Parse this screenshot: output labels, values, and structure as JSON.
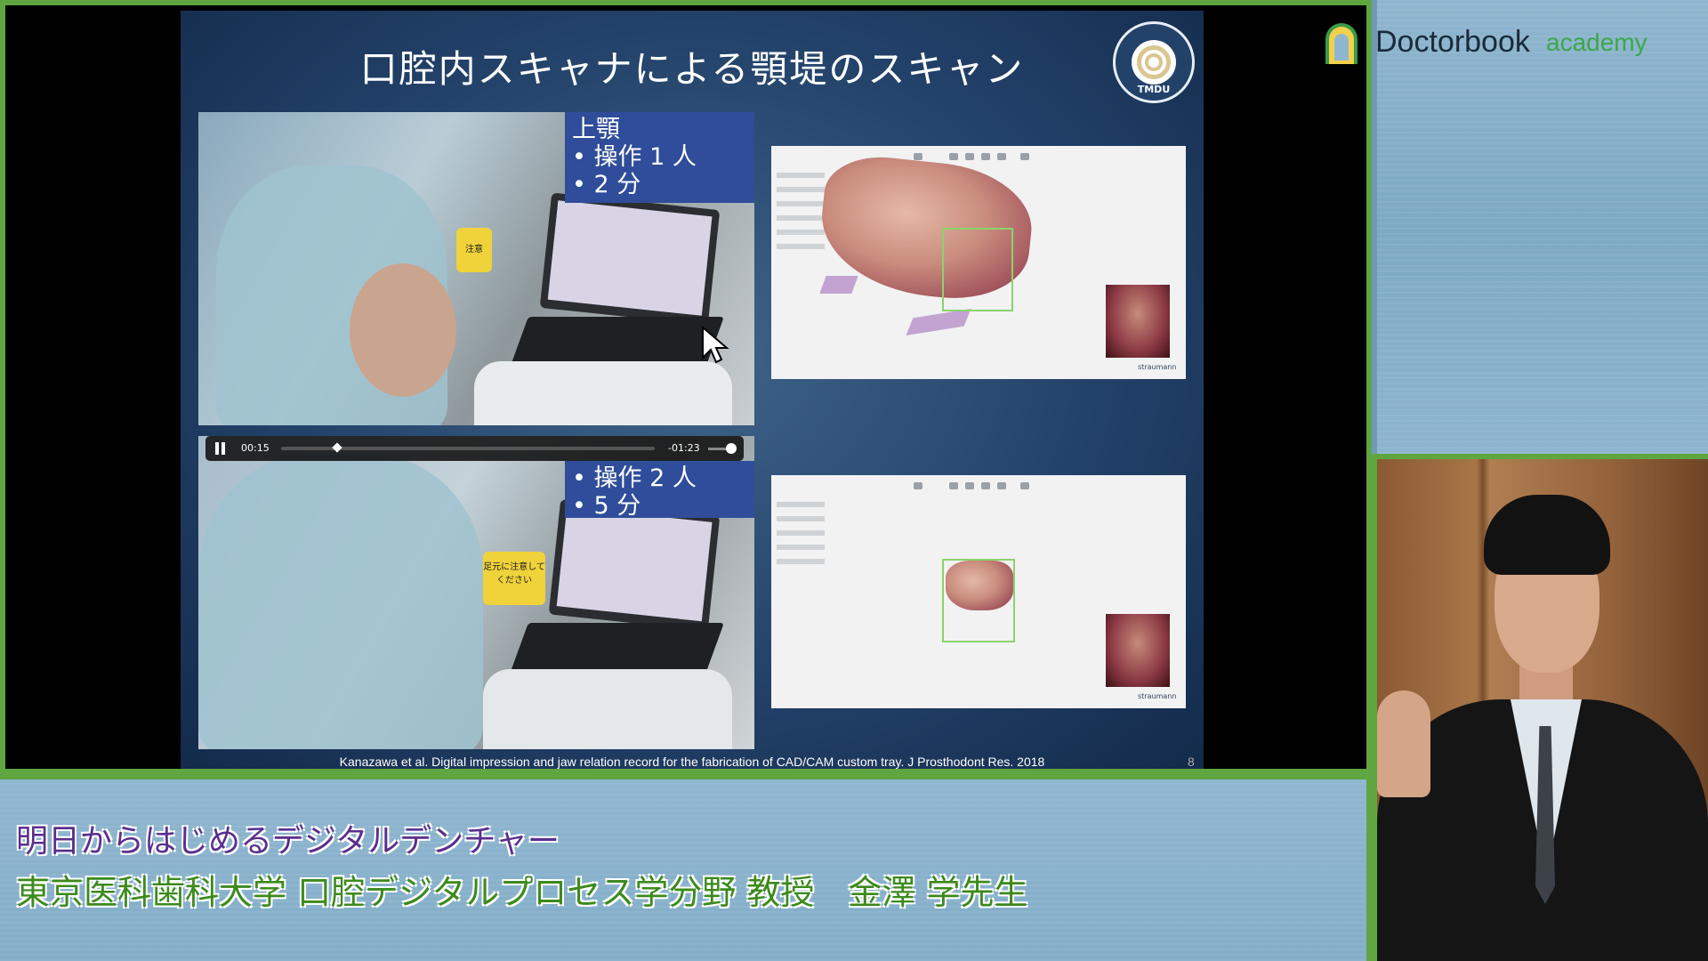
{
  "slide": {
    "title": "口腔内スキャナによる顎堤のスキャン",
    "seal_text": "TMDU",
    "upper_box": {
      "heading": "上顎",
      "line1": "• 操作 1 人",
      "line2": "• 2 分"
    },
    "lower_box": {
      "line1": "• 操作 2 人",
      "line2": "• 5 分"
    },
    "signs": {
      "top": "注意",
      "bottom": "足元に注意してください"
    },
    "citation": "Kanazawa et al. Digital impression and jaw relation record for the fabrication of CAD/CAM custom tray. J Prosthodont Res. 2018",
    "page_number": "8"
  },
  "video_player": {
    "current_time": "00:15",
    "remaining_time": "-01:23",
    "progress": 0.15
  },
  "scan_software": {
    "brand": "straumann"
  },
  "logo": {
    "main": "Doctorbook",
    "sub": "academy"
  },
  "caption": {
    "title": "明日からはじめるデジタルデンチャー",
    "speaker": "東京医科歯科大学 口腔デジタルプロセス学分野 教授　金澤 学先生"
  },
  "colors": {
    "frame_green": "#5fa640",
    "slide_blue": "#23426a",
    "info_box": "#2f4d9a",
    "caption_purple": "#5a2f8e",
    "caption_green": "#3c8a1c"
  }
}
